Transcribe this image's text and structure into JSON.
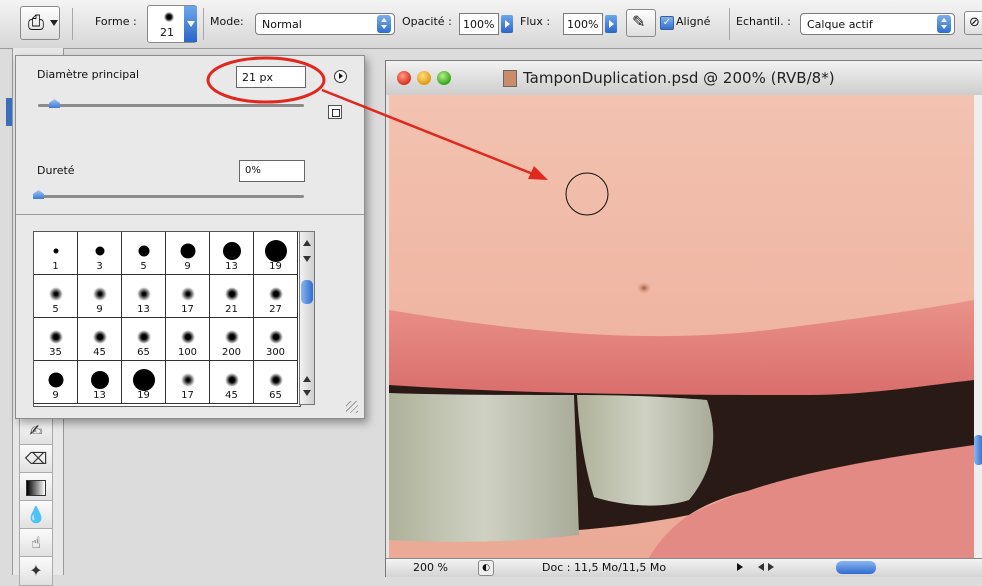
{
  "options_bar": {
    "forme_label": "Forme :",
    "brush_size": "21",
    "mode_label": "Mode:",
    "mode_value": "Normal",
    "opacite_label": "Opacité :",
    "opacite_value": "100%",
    "flux_label": "Flux :",
    "flux_value": "100%",
    "aligne_label": "Aligné",
    "aligne_checked": true,
    "echantil_label": "Echantil. :",
    "echantil_value": "Calque actif"
  },
  "brush_panel": {
    "diametre_label": "Diamètre principal",
    "diametre_value": "21 px",
    "diametre_slider": 0.06,
    "durete_label": "Dureté",
    "durete_value": "0%",
    "durete_slider": 0.0,
    "presets": [
      {
        "size": "1",
        "hard": true
      },
      {
        "size": "3",
        "hard": true
      },
      {
        "size": "5",
        "hard": true
      },
      {
        "size": "9",
        "hard": true
      },
      {
        "size": "13",
        "hard": true
      },
      {
        "size": "19",
        "hard": true
      },
      {
        "size": "5",
        "hard": false
      },
      {
        "size": "9",
        "hard": false
      },
      {
        "size": "13",
        "hard": false
      },
      {
        "size": "17",
        "hard": false
      },
      {
        "size": "21",
        "hard": false
      },
      {
        "size": "27",
        "hard": false
      },
      {
        "size": "35",
        "hard": false
      },
      {
        "size": "45",
        "hard": false
      },
      {
        "size": "65",
        "hard": false
      },
      {
        "size": "100",
        "hard": false
      },
      {
        "size": "200",
        "hard": false
      },
      {
        "size": "300",
        "hard": false
      },
      {
        "size": "9",
        "hard": true
      },
      {
        "size": "13",
        "hard": true
      },
      {
        "size": "19",
        "hard": true
      },
      {
        "size": "17",
        "hard": false
      },
      {
        "size": "45",
        "hard": false
      },
      {
        "size": "65",
        "hard": false
      }
    ]
  },
  "document": {
    "title": "TamponDuplication.psd @ 200% (RVB/8*)",
    "zoom": "200 %",
    "doc_info": "Doc : 11,5 Mo/11,5 Mo"
  },
  "tools": [
    "brush-tool-icon",
    "eraser-tool-icon",
    "gradient-tool-icon",
    "blur-tool-icon",
    "dodge-tool-icon"
  ],
  "colors": {
    "annotation_red": "#e0281e",
    "skin": "#f0b8a4",
    "lips": "#e07b77",
    "accent_blue": "#3a78d8"
  }
}
